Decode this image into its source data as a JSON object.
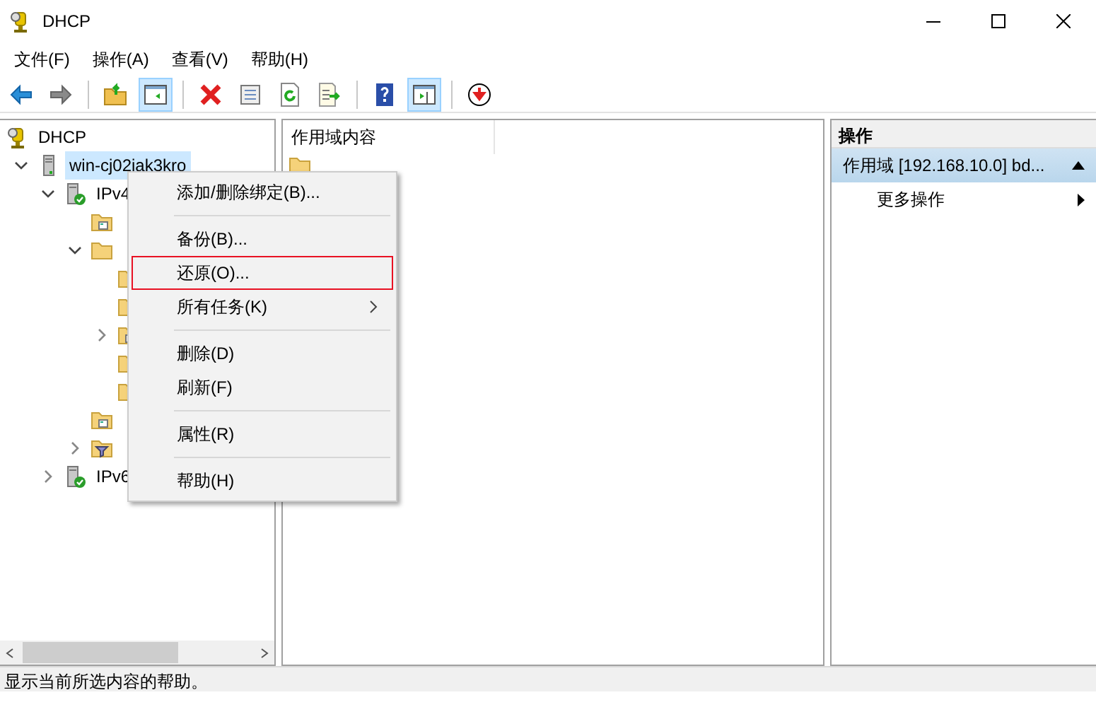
{
  "window": {
    "title": "DHCP"
  },
  "menu_bar": [
    "文件(F)",
    "操作(A)",
    "查看(V)",
    "帮助(H)"
  ],
  "toolbar": [
    {
      "kind": "back",
      "pressed": false
    },
    {
      "kind": "forward",
      "pressed": false
    },
    {
      "kind": "sep"
    },
    {
      "kind": "up",
      "pressed": false
    },
    {
      "kind": "tree",
      "pressed": true
    },
    {
      "kind": "sep"
    },
    {
      "kind": "delete",
      "pressed": false
    },
    {
      "kind": "properties",
      "pressed": false
    },
    {
      "kind": "refresh",
      "pressed": false
    },
    {
      "kind": "export",
      "pressed": false
    },
    {
      "kind": "sep"
    },
    {
      "kind": "help",
      "pressed": false
    },
    {
      "kind": "actionpane",
      "pressed": true
    },
    {
      "kind": "sep"
    },
    {
      "kind": "download",
      "pressed": false
    }
  ],
  "tree": [
    {
      "label": "DHCP",
      "kind": "dhcp",
      "selected": false,
      "children": [
        {
          "label": "win-cj02iak3kro",
          "kind": "server",
          "selected": true,
          "expanded": true,
          "children": [
            {
              "label": "IPv4",
              "kind": "ipv",
              "selected": false,
              "expanded": true,
              "children": [
                {
                  "kind": "options"
                },
                {
                  "kind": "folder",
                  "expanded": true,
                  "children": [
                    {
                      "kind": "folder"
                    },
                    {
                      "kind": "folder"
                    },
                    {
                      "kind": "options",
                      "expanded": false
                    },
                    {
                      "kind": "folder"
                    },
                    {
                      "kind": "folder"
                    }
                  ]
                },
                {
                  "kind": "options"
                },
                {
                  "kind": "filter",
                  "expanded": false
                }
              ]
            },
            {
              "label": "IPv6",
              "kind": "ipv",
              "selected": false,
              "expanded": false
            }
          ]
        }
      ]
    }
  ],
  "content": {
    "columns": [
      "作用域内容"
    ],
    "rows": [
      {
        "kind": "folder"
      }
    ]
  },
  "context_menu": [
    {
      "kind": "item",
      "label": "添加/删除绑定(B)...",
      "selected": false
    },
    {
      "kind": "sep"
    },
    {
      "kind": "item",
      "label": "备份(B)...",
      "selected": false
    },
    {
      "kind": "item",
      "label": "还原(O)...",
      "selected": true
    },
    {
      "kind": "submenu",
      "label": "所有任务(K)",
      "selected": false
    },
    {
      "kind": "sep"
    },
    {
      "kind": "item",
      "label": "删除(D)",
      "selected": false
    },
    {
      "kind": "item",
      "label": "刷新(F)",
      "selected": false
    },
    {
      "kind": "sep"
    },
    {
      "kind": "item",
      "label": "属性(R)",
      "selected": false
    },
    {
      "kind": "sep"
    },
    {
      "kind": "item",
      "label": "帮助(H)",
      "selected": false
    }
  ],
  "actions": {
    "title": "操作",
    "section": {
      "label": "作用域 [192.168.10.0] bd...",
      "expanded": true
    },
    "items": [
      "更多操作"
    ]
  },
  "status_bar": "显示当前所选内容的帮助。"
}
